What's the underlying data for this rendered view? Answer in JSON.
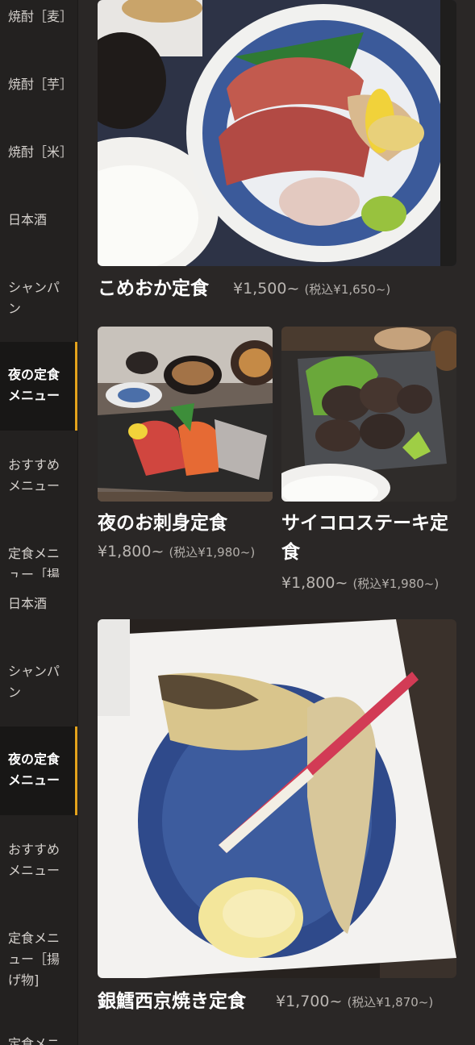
{
  "sidebar": {
    "items": [
      {
        "label": "焼酎［麦］"
      },
      {
        "label": "焼酎［芋］"
      },
      {
        "label": "焼酎［米］"
      },
      {
        "label": "日本酒"
      },
      {
        "label": "シャンパン"
      },
      {
        "label": "夜の定食メニュー"
      },
      {
        "label": "おすすめメニュー"
      },
      {
        "label": "定食メニュー［揚"
      },
      {
        "label": "日本酒"
      },
      {
        "label": "シャンパン"
      },
      {
        "label": "夜の定食メニュー"
      },
      {
        "label": "おすすめメニュー"
      },
      {
        "label": "定食メニュー［揚げ物]"
      },
      {
        "label": "定食メニ"
      }
    ]
  },
  "menu": {
    "items": [
      {
        "name": "こめおか定食",
        "price": "¥1,500~",
        "tax": "(税込¥1,650~)"
      },
      {
        "name": "夜のお刺身定食",
        "price": "¥1,800~",
        "tax": "(税込¥1,980~)"
      },
      {
        "name": "サイコロステーキ定食",
        "price": "¥1,800~",
        "tax": "(税込¥1,980~)"
      },
      {
        "name": "銀鱈西京焼き定食",
        "price": "¥1,700~",
        "tax": "(税込¥1,870~)"
      }
    ]
  },
  "colors": {
    "background": "#2a2726",
    "sidebar": "#232120",
    "active_item_bg": "#181716",
    "accent": "#e3a21c"
  }
}
